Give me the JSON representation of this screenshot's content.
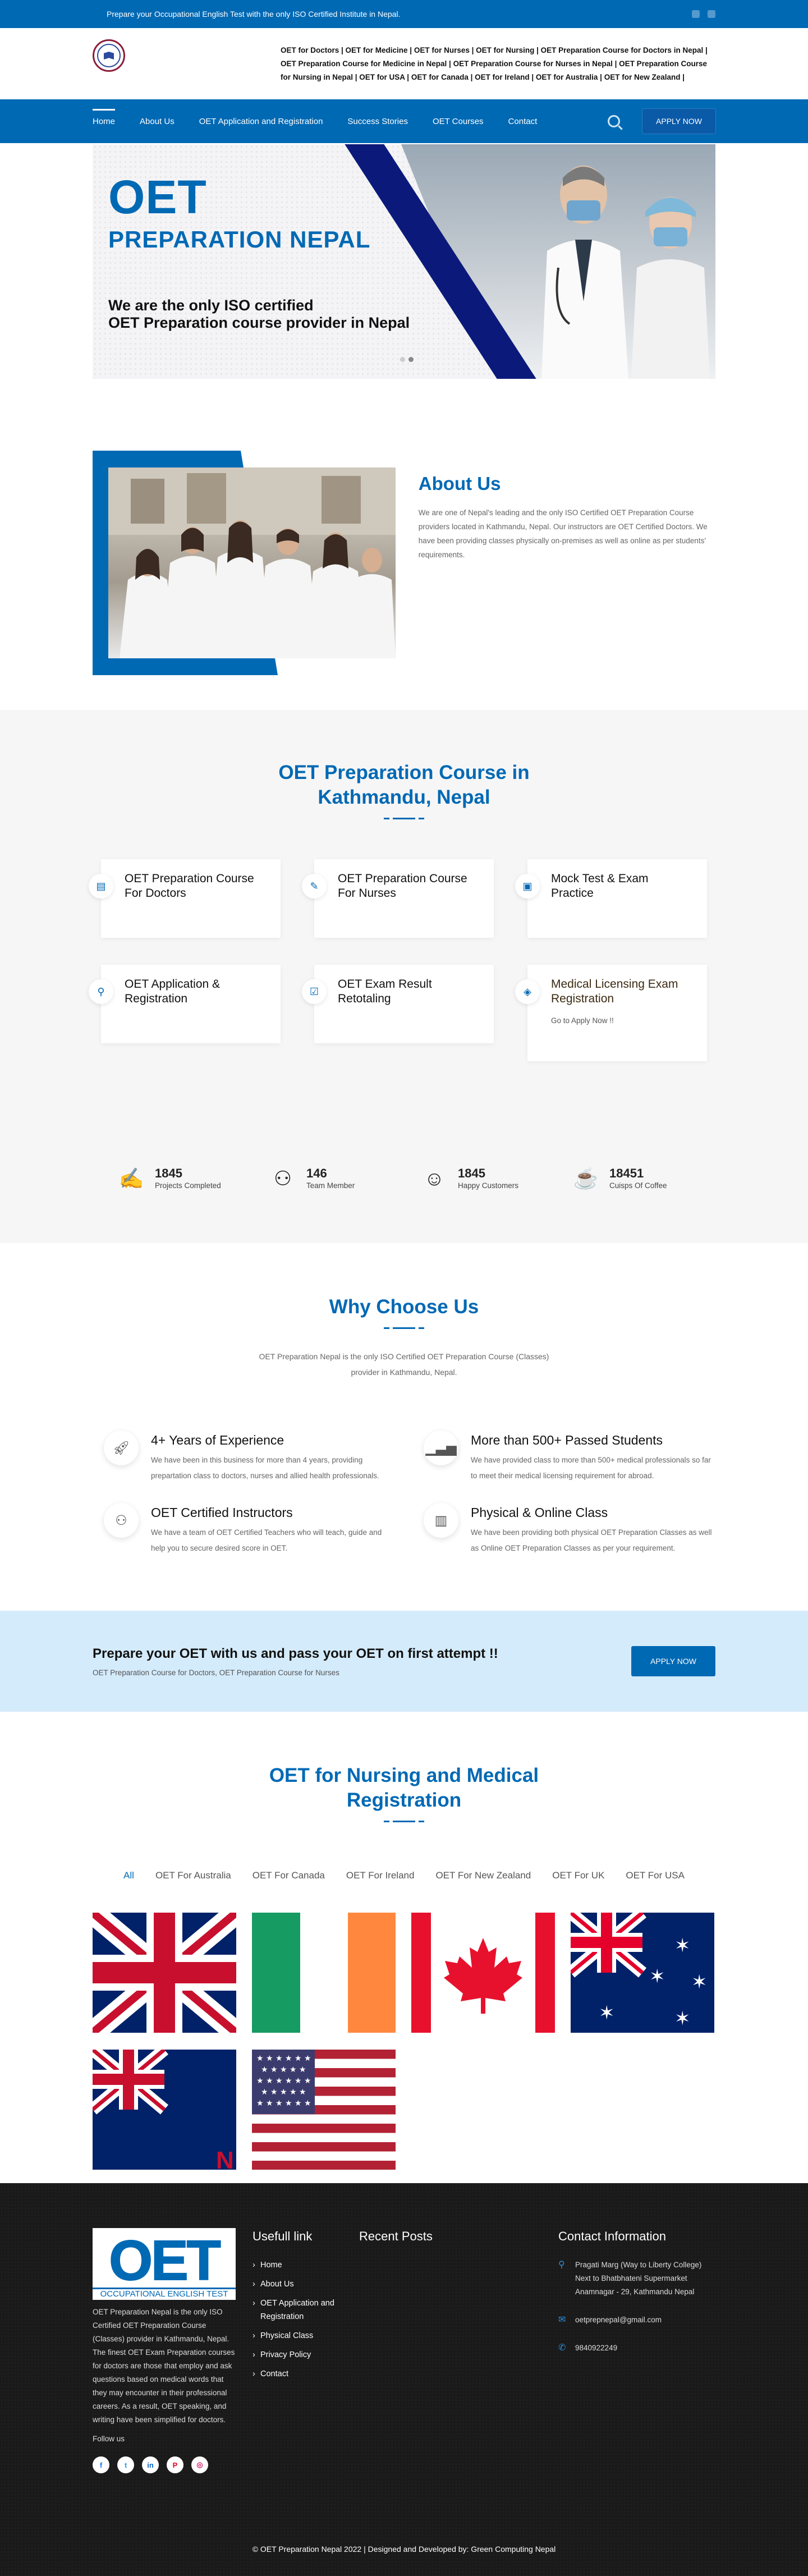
{
  "topbar": {
    "text": "Prepare your Occupational English Test with the only ISO Certified Institute in Nepal."
  },
  "header": {
    "links_text": "OET for Doctors | OET for Medicine | OET for Nurses | OET for Nursing | OET Preparation Course for Doctors in Nepal | OET Preparation Course for Medicine in Nepal | OET Preparation Course for Nurses in Nepal | OET Preparation Course for Nursing in Nepal | OET for USA | OET for Canada | OET for Ireland | OET for Australia | OET for New Zealand |"
  },
  "nav": {
    "items": [
      "Home",
      "About Us",
      "OET Application and Registration",
      "Success Stories",
      "OET Courses",
      "Contact"
    ],
    "apply": "APPLY NOW"
  },
  "hero": {
    "title": "OET",
    "subtitle": "PREPARATION NEPAL",
    "line1": "We are the only ISO certified",
    "line2": "OET Preparation course provider in Nepal"
  },
  "about": {
    "title": "About Us",
    "text": "We are one of Nepal's leading and the only ISO Certified OET Preparation Course providers located in Kathmandu, Nepal. Our instructors are OET Certified Doctors. We have been providing classes physically on-premises as well as online as per students' requirements."
  },
  "course": {
    "title": "OET Preparation Course in Kathmandu, Nepal",
    "cards": [
      {
        "icon": "book-icon",
        "title": "OET Preparation Course For Doctors"
      },
      {
        "icon": "edit-icon",
        "title": "OET Preparation Course For Nurses"
      },
      {
        "icon": "exam-icon",
        "title": "Mock Test & Exam Practice"
      },
      {
        "icon": "application-icon",
        "title": "OET Application & Registration"
      },
      {
        "icon": "result-icon",
        "title": "OET Exam Result Retotaling"
      },
      {
        "icon": "license-icon",
        "title": "Medical Licensing Exam Registration",
        "link": "Go to Apply Now !!"
      }
    ],
    "stats": [
      {
        "icon": "projects-icon",
        "value": "1845",
        "label": "Projects Completed"
      },
      {
        "icon": "team-icon",
        "value": "146",
        "label": "Team Member"
      },
      {
        "icon": "customer-icon",
        "value": "1845",
        "label": "Happy Customers"
      },
      {
        "icon": "coffee-icon",
        "value": "18451",
        "label": "Cuisps Of Coffee"
      }
    ]
  },
  "why": {
    "title": "Why Choose Us",
    "intro": "OET Preparation Nepal is the only ISO Certified OET Preparation Course (Classes) provider in Kathmandu, Nepal.",
    "items": [
      {
        "icon": "rocket-icon",
        "title": "4+ Years of Experience",
        "text": "We have been in this business for more than 4 years, providing prepartation class to doctors, nurses and allied health professionals."
      },
      {
        "icon": "chart-icon",
        "title": "More than 500+ Passed Students",
        "text": "We have provided class to more than 500+ medical professionals so far to meet their medical licensing requirement for abroad."
      },
      {
        "icon": "instructor-icon",
        "title": "OET Certified Instructors",
        "text": "We have a team of OET Certified Teachers who will teach, guide and help you to secure desired score in OET."
      },
      {
        "icon": "class-icon",
        "title": "Physical & Online Class",
        "text": "We have been providing both physical OET Preparation Classes as well as Online OET Preparation Classes as per your requirement."
      }
    ]
  },
  "cta": {
    "title": "Prepare your OET with us and pass your OET on first attempt !!",
    "subtitle": "OET Preparation Course for Doctors, OET Preparation Course for Nurses",
    "button": "APPLY NOW"
  },
  "nursing": {
    "title": "OET for Nursing and Medical Registration",
    "filters": [
      "All",
      "OET For Australia",
      "OET For Canada",
      "OET For Ireland",
      "OET For New Zealand",
      "OET For UK",
      "OET For USA"
    ]
  },
  "footer": {
    "logo_big": "OET",
    "logo_small": "OCCUPATIONAL ENGLISH TEST",
    "about_text": "OET Preparation Nepal is the only ISO Certified OET Preparation Course (Classes) provider in Kathmandu, Nepal. The finest OET Exam Preparation courses for doctors are those that employ and ask questions based on medical words that they may encounter in their professional careers. As a result, OET speaking, and writing have been simplified for doctors.",
    "follow": "Follow us",
    "useful_title": "Usefull link",
    "useful_links": [
      "Home",
      "About Us",
      "OET Application and Registration",
      "Physical Class",
      "Privacy Policy",
      "Contact"
    ],
    "recent_title": "Recent Posts",
    "contact_title": "Contact Information",
    "address": "Pragati Marg (Way to Liberty College) Next to Bhatbhateni Supermarket Anamnagar - 29, Kathmandu Nepal",
    "email": "oetprepnepal@gmail.com",
    "phone": "9840922249",
    "copyright": "© OET Preparation Nepal 2022 | Designed and Developed by: Green Computing Nepal"
  },
  "colors": {
    "primary": "#0069b4",
    "cta_bg": "#d4ebfb",
    "footer_bg": "#1a1a1a"
  }
}
